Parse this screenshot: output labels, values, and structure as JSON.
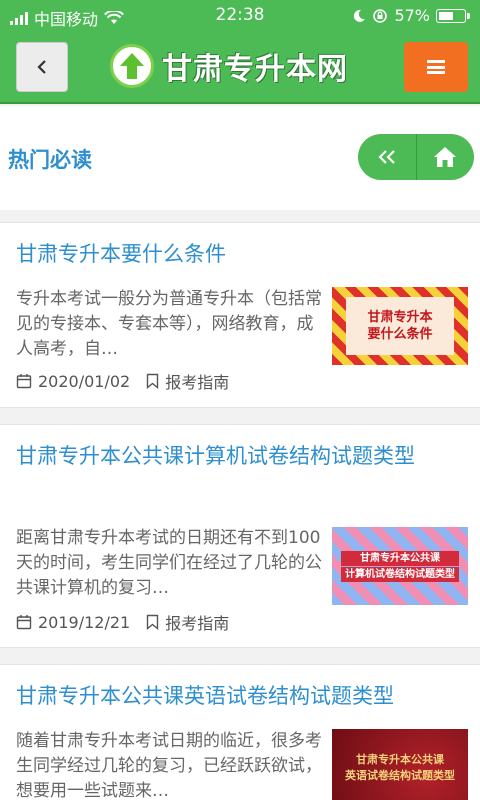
{
  "status_bar": {
    "carrier": "中国移动",
    "time": "22:38",
    "battery": "57%",
    "battery_level": 0.57
  },
  "header": {
    "logo_text": "甘肃专升本网",
    "back_icon": "chevron-left-icon",
    "menu_icon": "hamburger-icon"
  },
  "section": {
    "title": "热门必读",
    "nav": [
      "double-chevron-left-icon",
      "home-icon"
    ]
  },
  "articles": [
    {
      "title": "甘肃专升本要什么条件",
      "excerpt": "专升本考试一般分为普通专升本（包括常见的专接本、专套本等），网络教育，成人高考，自…",
      "date": "2020/01/02",
      "category": "报考指南",
      "thumb_lines": [
        "甘肃专升本",
        "要什么条件"
      ]
    },
    {
      "title": "甘肃专升本公共课计算机试卷结构试题类型",
      "excerpt": "距离甘肃专升本考试的日期还有不到100天的时间，考生同学们在经过了几轮的公共课计算机的复习…",
      "date": "2019/12/21",
      "category": "报考指南",
      "thumb_lines": [
        "甘肃专升本公共课",
        "计算机试卷结构试题类型"
      ]
    },
    {
      "title": "甘肃专升本公共课英语试卷结构试题类型",
      "excerpt": "随着甘肃专升本考试日期的临近，很多考生同学经过几轮的复习，已经跃跃欲试，想要用一些试题来…",
      "thumb_lines": [
        "甘肃专升本公共课",
        "英语试卷结构试题类型"
      ]
    }
  ]
}
